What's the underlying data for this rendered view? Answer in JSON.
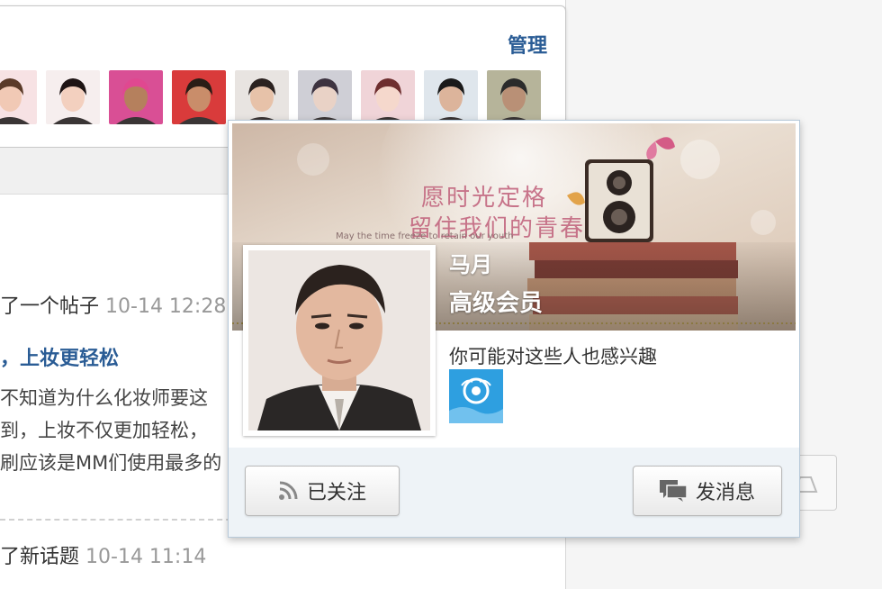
{
  "follow_panel": {
    "manage_label": "管理",
    "avatars": [
      {
        "skin": "#f1c9b5",
        "hair": "#5a3a28",
        "bg": "#f7e2e4"
      },
      {
        "skin": "#f3d0bf",
        "hair": "#1e1414",
        "bg": "#f6eeee"
      },
      {
        "skin": "#b5805d",
        "hair": "#e04890",
        "bg": "#d94f95"
      },
      {
        "skin": "#c98d6a",
        "hair": "#2a1d16",
        "bg": "#d93b3b"
      },
      {
        "skin": "#e7c2a9",
        "hair": "#2b2220",
        "bg": "#e8e4e1"
      },
      {
        "skin": "#e9d2c6",
        "hair": "#3d3340",
        "bg": "#cfcfd6"
      },
      {
        "skin": "#f5d8cc",
        "hair": "#6e2f2f",
        "bg": "#f0d4d8"
      },
      {
        "skin": "#dcb49b",
        "hair": "#1a1a1a",
        "bg": "#dfe6ec"
      },
      {
        "skin": "#b99076",
        "hair": "#2b2b2b",
        "bg": "#b6b49a"
      }
    ]
  },
  "feed": {
    "line1_text": "了一个帖子",
    "line1_time": "10-14 12:28",
    "title": "，上妆更轻松",
    "body_lines": [
      "不知道为什么化妆师要这",
      "到，上妆不仅更加轻松，",
      "刷应该是MM们使用最多的"
    ],
    "line2_text": "了新话题",
    "line2_time": "10-14 11:14"
  },
  "popup": {
    "banner_title_1": "愿时光定格",
    "banner_title_2": "留住我们的青春",
    "banner_subtitle": "May the time freeze to retain our youth",
    "user_name": "马月",
    "user_level": "高级会员",
    "suggest_label": "你可能对这些人也感兴趣",
    "follow_button_label": "已关注",
    "message_button_label": "发消息"
  },
  "colors": {
    "link_blue": "#2a5c95",
    "time_gray": "#999999",
    "footer_bg": "#eef3f7"
  }
}
